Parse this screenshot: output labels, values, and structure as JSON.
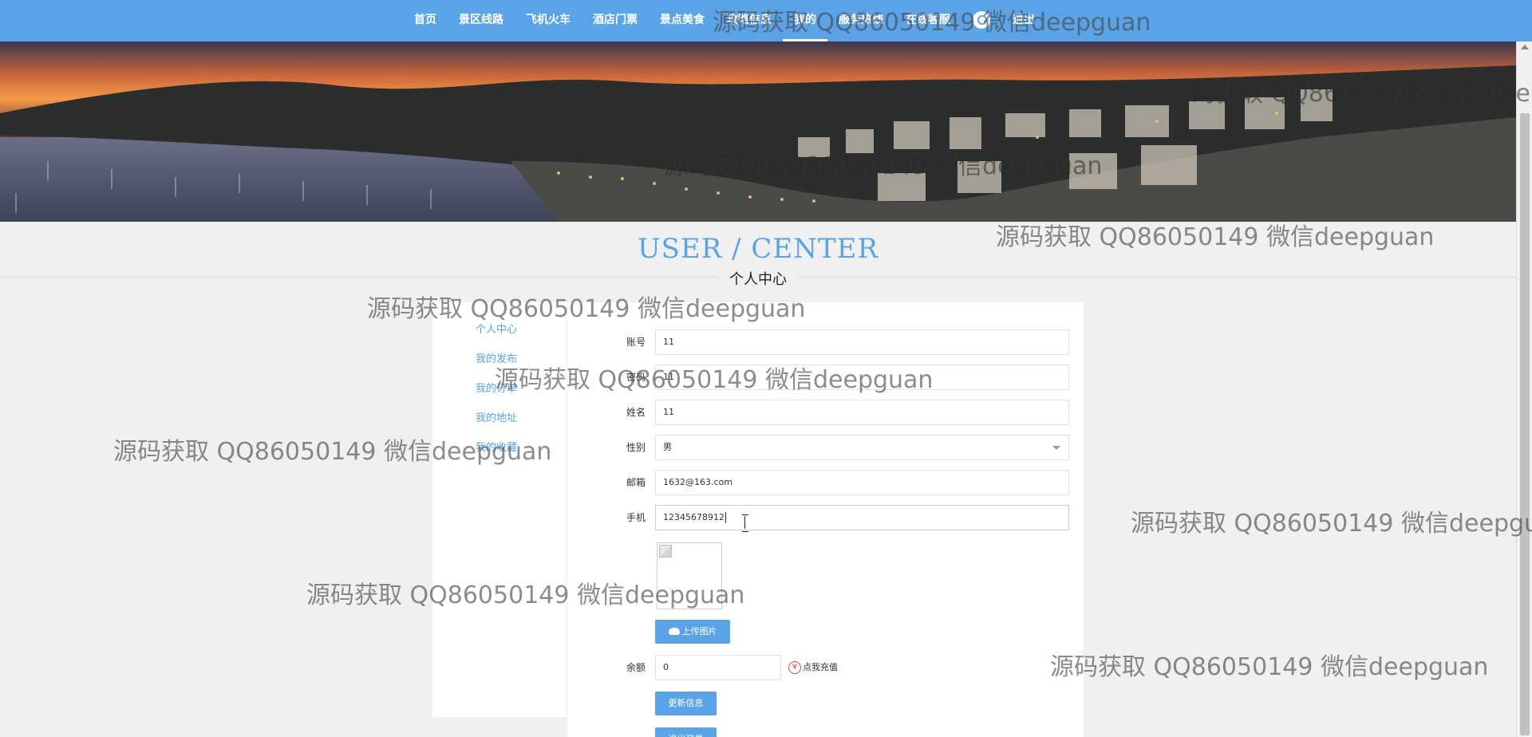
{
  "nav": {
    "items": [
      "首页",
      "景区线路",
      "飞机火车",
      "酒店门票",
      "景点美食",
      "攻略信息",
      "我的",
      "服务热线",
      "在线客服",
      "退出"
    ],
    "active_index": 6
  },
  "header": {
    "title_en": "USER / CENTER",
    "title_cn": "个人中心"
  },
  "sidebar": {
    "items": [
      "个人中心",
      "我的发布",
      "我的订单",
      "我的地址",
      "我的收藏"
    ]
  },
  "form": {
    "fields": [
      {
        "label": "账号",
        "value": "11"
      },
      {
        "label": "密码",
        "value": "11"
      },
      {
        "label": "姓名",
        "value": "11"
      },
      {
        "label": "性别",
        "value": "男"
      },
      {
        "label": "邮箱",
        "value": "1632@163.com"
      },
      {
        "label": "手机",
        "value": "12345678912"
      }
    ],
    "upload_label": "上传图片",
    "balance_label": "余额",
    "balance_value": "0",
    "recharge_label": "点我充值",
    "update_label": "更新信息",
    "logout_label": "退出登录"
  },
  "watermark": {
    "text": "源码获取 QQ86050149 微信deepguan"
  },
  "colors": {
    "accent": "#5aa3e6",
    "background": "#f0f0f0",
    "recharge_icon": "#e04040"
  },
  "icons": {
    "logo": "circle-logo-icon",
    "upload": "cloud-upload-icon",
    "recharge": "yen-icon",
    "dropdown": "chevron-down-icon"
  }
}
